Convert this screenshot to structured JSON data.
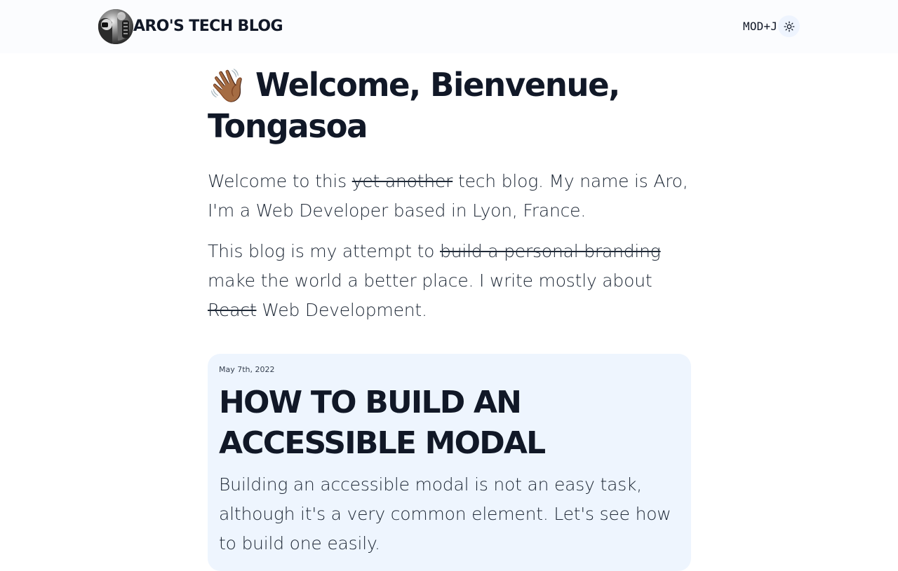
{
  "header": {
    "site_title": "Aro's Tech blog",
    "shortcut": "MOD+J",
    "avatar_icon": "avatar-image",
    "theme_icon": "sun-icon"
  },
  "hero": {
    "title_emoji": "👋🏾",
    "title": "Welcome, Bienvenue, Tongasoa",
    "intro": {
      "p1_before": "Welcome to this ",
      "p1_struck": "yet another",
      "p1_after": " tech blog. My name is Aro, I'm a Web Developer based in Lyon, France.",
      "p2_before": "This blog is my attempt to ",
      "p2_struck_1": "build a personal branding",
      "p2_middle": " make the world a better place. I write mostly about ",
      "p2_struck_2": "React",
      "p2_after": " Web Development."
    }
  },
  "posts": [
    {
      "date": "May 7th, 2022",
      "title": "How to build an accessible modal",
      "excerpt": "Building an accessible modal is not an easy task, although it's a very common element. Let's see how to build one easily."
    }
  ],
  "colors": {
    "header_bg": "#fbfcfe",
    "card_bg": "#eef5fe",
    "text": "#111827"
  }
}
